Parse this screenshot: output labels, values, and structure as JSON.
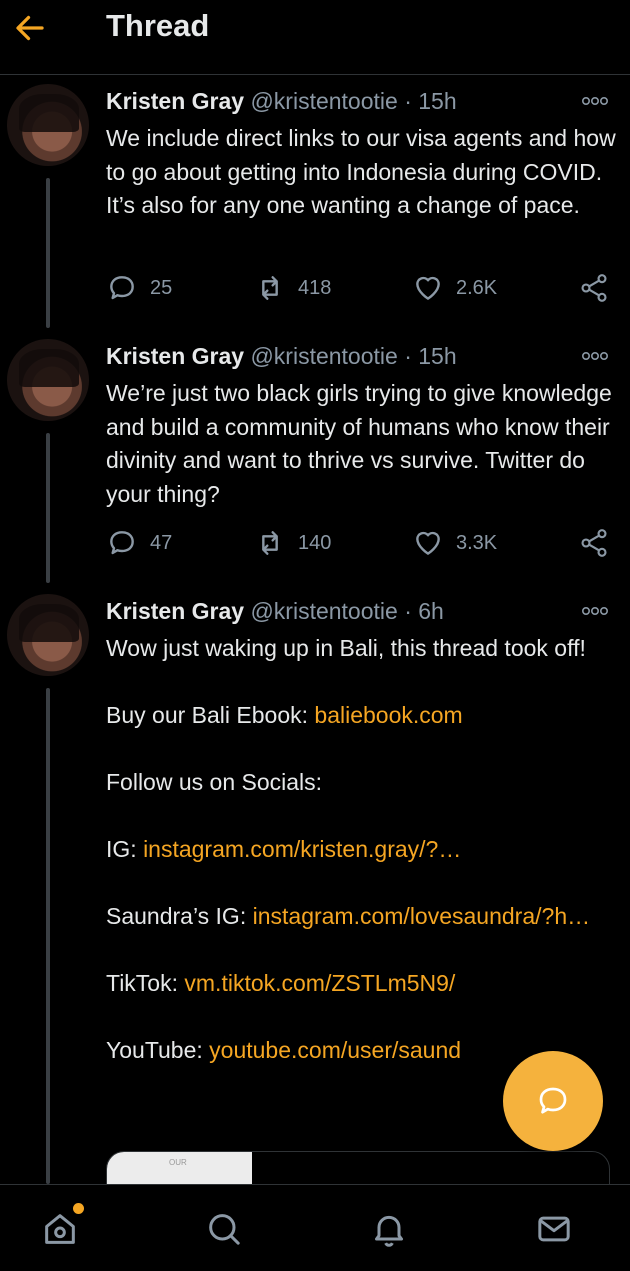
{
  "header": {
    "title": "Thread"
  },
  "tweets": [
    {
      "name": "Kristen Gray",
      "handle": "@kristentootie",
      "separator": "·",
      "time": "15h",
      "text": "We include direct links to our visa agents and how to go about getting into Indonesia during COVID. It’s also for any one wanting a change of pace.",
      "replies": "25",
      "retweets": "418",
      "likes": "2.6K"
    },
    {
      "name": "Kristen Gray",
      "handle": "@kristentootie",
      "separator": "·",
      "time": "15h",
      "text": "We’re just two black girls trying to give knowledge and build a community of humans who know their divinity and want to thrive vs survive. Twitter do your thing?",
      "replies": "47",
      "retweets": "140",
      "likes": "3.3K"
    },
    {
      "name": "Kristen Gray",
      "handle": "@kristentootie",
      "separator": "·",
      "time": "6h",
      "line1": "Wow just waking up in Bali, this thread took off!",
      "ebook_label": "Buy our Bali Ebook: ",
      "ebook_link": "baliebook.com",
      "follow": "Follow us on Socials:",
      "ig_label": "IG: ",
      "ig_link": "instagram.com/kristen.gray/?…",
      "saundra_label": "Saundra’s IG: ",
      "saundra_link": "instagram.com/lovesaundra/?h…",
      "tiktok_label": "TikTok: ",
      "tiktok_link": "vm.tiktok.com/ZSTLm5N9/",
      "youtube_label": "YouTube: ",
      "youtube_link": "youtube.com/user/saund",
      "card_thumb_text": "OUR"
    }
  ],
  "icons": {
    "back": "arrow-left-icon",
    "more": "more-icon",
    "reply": "reply-icon",
    "retweet": "retweet-icon",
    "like": "heart-icon",
    "share": "share-icon",
    "compose": "compose-icon",
    "home": "home-icon",
    "search": "search-icon",
    "notifications": "bell-icon",
    "messages": "mail-icon"
  },
  "colors": {
    "accent": "#f5a623",
    "fab": "#f5b23d",
    "text": "#e7e9ea",
    "muted": "#8b98a5",
    "background": "#000000"
  }
}
